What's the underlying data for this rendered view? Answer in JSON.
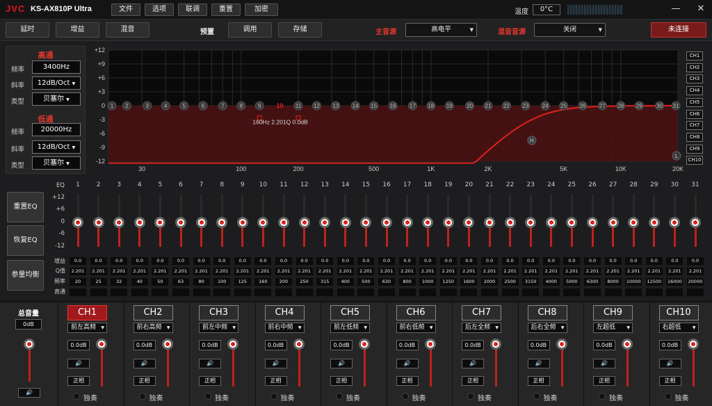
{
  "app": {
    "logo": "JVC",
    "model": "KS-AX810P Ultra"
  },
  "menu": [
    "文件",
    "选项",
    "联调",
    "重置",
    "加密"
  ],
  "temp": {
    "label": "温度",
    "value": "0°C"
  },
  "window": {
    "minimize": "—",
    "close": "✕"
  },
  "toolbar": {
    "delay": "延时",
    "gain": "增益",
    "mix": "混音",
    "preset_label": "预置",
    "recall": "调用",
    "store": "存储",
    "main_src_label": "主音源",
    "main_src": "高电平",
    "mix_src_label": "混音音源",
    "mix_src": "关闭",
    "connect": "未连接"
  },
  "filter": {
    "hp_title": "高通",
    "lp_title": "低通",
    "freq_label": "频率",
    "slope_label": "斜率",
    "type_label": "类型",
    "hp_freq": "3400Hz",
    "hp_slope": "12dB/Oct",
    "hp_type": "贝塞尔",
    "lp_freq": "20000Hz",
    "lp_slope": "12dB/Oct",
    "lp_type": "贝塞尔"
  },
  "graph": {
    "y_ticks": [
      "+12",
      "+9",
      "+6",
      "+3",
      "0",
      "-3",
      "-6",
      "-9",
      "-12"
    ],
    "x_ticks": [
      "30",
      "100",
      "200",
      "500",
      "1K",
      "2K",
      "5K",
      "10K",
      "20K"
    ],
    "tooltip": "160Hz  2.201Q  0.0dB",
    "marker_h": "H",
    "marker_l": "L",
    "active_band": "10"
  },
  "channels_side": [
    "CH1",
    "CH2",
    "CH3",
    "CH4",
    "CH5",
    "CH6",
    "CH7",
    "CH8",
    "CH9",
    "CH10"
  ],
  "eq": {
    "reset": "重置EQ",
    "restore": "恢复EQ",
    "param": "参量均衡",
    "label": "EQ",
    "scale": [
      "+12",
      "+6",
      "0",
      "-6",
      "-12"
    ],
    "row_labels": {
      "gain": "增益",
      "q": "Q值",
      "freq": "频率",
      "bypass": "直通"
    },
    "bands": [
      "1",
      "2",
      "3",
      "4",
      "5",
      "6",
      "7",
      "8",
      "9",
      "10",
      "11",
      "12",
      "13",
      "14",
      "15",
      "16",
      "17",
      "18",
      "19",
      "20",
      "21",
      "22",
      "23",
      "24",
      "25",
      "26",
      "27",
      "28",
      "29",
      "30",
      "31"
    ],
    "gains": [
      "0.0",
      "0.0",
      "0.0",
      "0.0",
      "0.0",
      "0.0",
      "0.0",
      "0.0",
      "0.0",
      "0.0",
      "0.0",
      "0.0",
      "0.0",
      "0.0",
      "0.0",
      "0.0",
      "0.0",
      "0.0",
      "0.0",
      "0.0",
      "0.0",
      "0.0",
      "0.0",
      "0.0",
      "0.0",
      "0.0",
      "0.0",
      "0.0",
      "0.0",
      "0.0",
      "0.0"
    ],
    "q": "2.201",
    "freqs": [
      "20",
      "25",
      "32",
      "40",
      "50",
      "63",
      "80",
      "100",
      "125",
      "160",
      "200",
      "250",
      "315",
      "400",
      "500",
      "630",
      "800",
      "1000",
      "1250",
      "1600",
      "2000",
      "2500",
      "3150",
      "4000",
      "5000",
      "6300",
      "8000",
      "10000",
      "12500",
      "16000",
      "20000"
    ]
  },
  "master": {
    "label": "总音量",
    "value": "0dB",
    "speaker": "🔊"
  },
  "outputs": [
    {
      "name": "CH1",
      "pos": "前左高频",
      "gain": "0.0dB",
      "phase": "正相",
      "solo": "独奏",
      "active": true
    },
    {
      "name": "CH2",
      "pos": "前右高频",
      "gain": "0.0dB",
      "phase": "正相",
      "solo": "独奏"
    },
    {
      "name": "CH3",
      "pos": "前左中频",
      "gain": "0.0dB",
      "phase": "正相",
      "solo": "独奏"
    },
    {
      "name": "CH4",
      "pos": "前右中频",
      "gain": "0.0dB",
      "phase": "正相",
      "solo": "独奏"
    },
    {
      "name": "CH5",
      "pos": "前左低频",
      "gain": "0.0dB",
      "phase": "正相",
      "solo": "独奏"
    },
    {
      "name": "CH6",
      "pos": "前右低频",
      "gain": "0.0dB",
      "phase": "正相",
      "solo": "独奏"
    },
    {
      "name": "CH7",
      "pos": "后左全频",
      "gain": "0.0dB",
      "phase": "正相",
      "solo": "独奏"
    },
    {
      "name": "CH8",
      "pos": "后右全频",
      "gain": "0.0dB",
      "phase": "正相",
      "solo": "独奏"
    },
    {
      "name": "CH9",
      "pos": "左超低",
      "gain": "0.0dB",
      "phase": "正相",
      "solo": "独奏"
    },
    {
      "name": "CH10",
      "pos": "右超低",
      "gain": "0.0dB",
      "phase": "正相",
      "solo": "独奏"
    }
  ],
  "colors": {
    "accent": "#e0211c",
    "bg": "#1d1d1f"
  }
}
